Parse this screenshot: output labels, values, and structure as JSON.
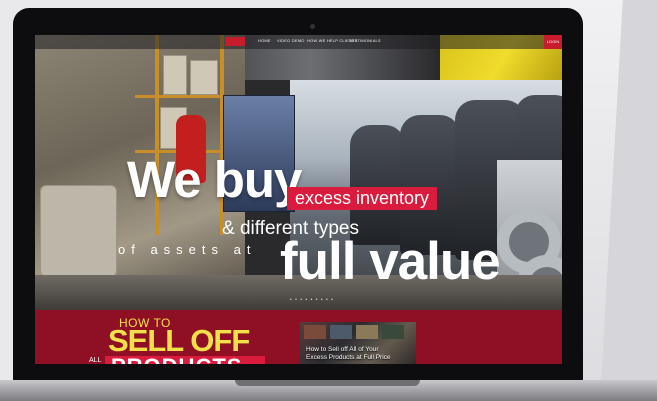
{
  "nav": {
    "items": [
      "HOME",
      "VIDEO DEMO",
      "HOW WE HELP CLIENTS",
      "TESTIMONIALS"
    ],
    "login": "LOGIN"
  },
  "hero": {
    "line1": "We buy",
    "highlight": "excess inventory",
    "line2": "& different types",
    "line3": "of assets at",
    "line4": "full value",
    "pager": "• • • • • • • • •"
  },
  "promo": {
    "howto": "HOW TO",
    "sell_off": "SELL OFF",
    "all": "ALL",
    "products": "PRODUCTS",
    "video_title_1": "How to Sell off All of Your",
    "video_title_2": "Excess Products at Full Price"
  },
  "colors": {
    "brand_red": "#c71c2c",
    "highlight_red": "#d91c3e",
    "promo_bg": "#8f1024",
    "promo_text": "#f2e04a"
  }
}
